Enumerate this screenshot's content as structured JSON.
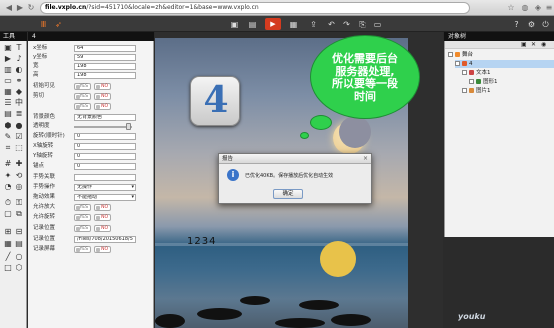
{
  "browser": {
    "url_host": "file.vxplo.cn",
    "url_rest": "/?sid=451710&locale=zh&editor=1&base=www.vxplo.cn",
    "back_icon": "back-arrow-icon",
    "forward_icon": "forward-arrow-icon",
    "refresh_icon": "refresh-icon",
    "star_icon": "star-icon"
  },
  "toolbar": {
    "logo_icon": "vxplo-logo-icon",
    "play_icon": "play-icon"
  },
  "tools_panel": {
    "title": "工具"
  },
  "properties": {
    "title": "4",
    "rows": [
      {
        "label": "x坐标",
        "value": "64"
      },
      {
        "label": "y坐标",
        "value": "59"
      },
      {
        "label": "宽",
        "value": "198"
      },
      {
        "label": "高",
        "value": "198"
      },
      {
        "label": "初始可见",
        "toggle": "YES"
      },
      {
        "label": "剪切",
        "toggle": "YES"
      },
      {
        "label": "",
        "toggle": "YES"
      },
      {
        "label": "背景颜色",
        "value": "无背景颜色"
      },
      {
        "label": "透明度",
        "value": ""
      },
      {
        "label": "旋转(顺时针)",
        "value": "0"
      },
      {
        "label": "X轴旋转",
        "value": "0"
      },
      {
        "label": "Y轴旋转",
        "value": "0"
      },
      {
        "label": "锚点",
        "value": "0"
      },
      {
        "label": "手势关联",
        "value": ""
      },
      {
        "label": "手势操作",
        "select": "无操作"
      },
      {
        "label": "拖动效果",
        "select": "不能拖动"
      },
      {
        "label": "允许放大",
        "toggle": "NO"
      },
      {
        "label": "允许旋转",
        "toggle": "NO"
      },
      {
        "label": "记录位置",
        "toggle": "YES"
      },
      {
        "label": "记录位置",
        "value": "/Files/708/20150618/5"
      },
      {
        "label": "记录屏幕",
        "toggle": "YES"
      }
    ]
  },
  "canvas": {
    "app_icon_text": "4",
    "number_text": "1234"
  },
  "bubble": {
    "text_lines": [
      "优化需要后台",
      "服务器处理,",
      "所以要等一段",
      "时间"
    ]
  },
  "dialog": {
    "title": "报告",
    "message": "已优化40KB。保存播放后优化自动生效",
    "ok": "确定"
  },
  "object_tree": {
    "title": "对象树",
    "items": [
      {
        "label": "舞台",
        "level": 0
      },
      {
        "label": "4",
        "level": 1,
        "selected": true
      },
      {
        "label": "文本1",
        "level": 2
      },
      {
        "label": "图形1",
        "level": 3
      },
      {
        "label": "图片1",
        "level": 2
      }
    ]
  },
  "watermark": "youku",
  "colors": {
    "play": "#d43b1f",
    "bubble": "#2fd04c",
    "sun": "#e8c24a",
    "selection": "#b6d4f2"
  }
}
